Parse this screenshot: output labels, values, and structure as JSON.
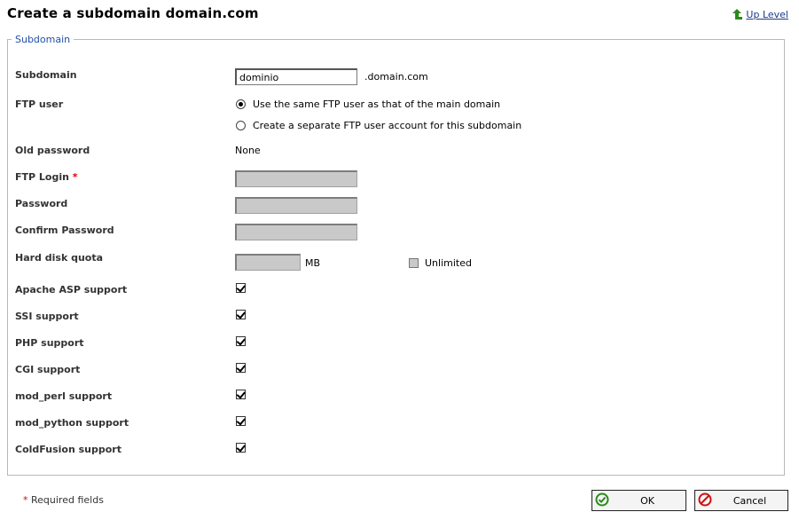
{
  "header": {
    "title": "Create a subdomain domain.com",
    "up_level": "Up Level"
  },
  "section": {
    "legend": "Subdomain"
  },
  "form": {
    "subdomain": {
      "label": "Subdomain",
      "value": "dominio",
      "suffix": ".domain.com"
    },
    "ftp_user": {
      "label": "FTP user",
      "options": [
        {
          "label": "Use the same FTP user as that of the main domain",
          "selected": true
        },
        {
          "label": "Create a separate FTP user account for this subdomain",
          "selected": false
        }
      ]
    },
    "old_password": {
      "label": "Old password",
      "value": "None"
    },
    "ftp_login": {
      "label": "FTP Login",
      "required_mark": "*",
      "value": ""
    },
    "password": {
      "label": "Password",
      "value": ""
    },
    "confirm_password": {
      "label": "Confirm Password",
      "value": ""
    },
    "quota": {
      "label": "Hard disk quota",
      "value": "",
      "unit": "MB",
      "unlimited_label": "Unlimited",
      "unlimited_checked": false
    },
    "features": [
      {
        "label": "Apache ASP support",
        "checked": true
      },
      {
        "label": "SSI support",
        "checked": true
      },
      {
        "label": "PHP support",
        "checked": true
      },
      {
        "label": "CGI support",
        "checked": true
      },
      {
        "label": "mod_perl support",
        "checked": true
      },
      {
        "label": "mod_python support",
        "checked": true
      },
      {
        "label": "ColdFusion support",
        "checked": true
      }
    ]
  },
  "footer": {
    "required_mark": "*",
    "required_text": "Required fields",
    "ok_label": "OK",
    "cancel_label": "Cancel"
  },
  "colors": {
    "legend": "#2050a8",
    "required": "#e00000",
    "up_arrow": "#2a8a1a",
    "ok_icon": "#2a8a1a",
    "cancel_icon": "#d01010"
  }
}
